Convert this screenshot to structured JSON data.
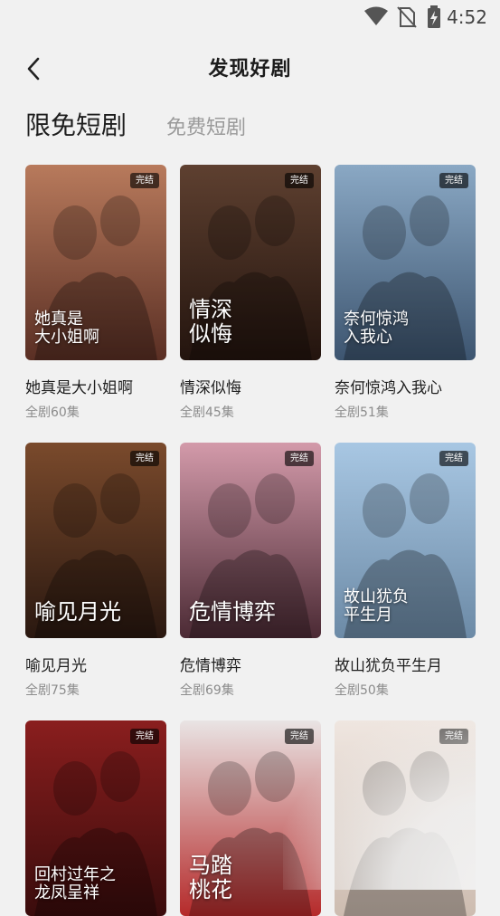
{
  "status_bar": {
    "time": "4:52",
    "icons": [
      "wifi-icon",
      "no-sim-icon",
      "battery-charging-icon"
    ]
  },
  "header": {
    "back_icon": "chevron-left-icon",
    "title": "发现好剧"
  },
  "tabs": [
    {
      "label": "限免短剧",
      "active": true
    },
    {
      "label": "免费短剧",
      "active": false
    }
  ],
  "dramas": [
    {
      "title": "她真是大小姐啊",
      "episodes": "全剧60集",
      "badge": "完结",
      "poster_text": "她真是\n大小姐啊",
      "colors": [
        "#b87a5c",
        "#5a2f24"
      ]
    },
    {
      "title": "情深似悔",
      "episodes": "全剧45集",
      "badge": "完结",
      "poster_text": "情深\n似悔",
      "colors": [
        "#5e4030",
        "#23140e"
      ]
    },
    {
      "title": "奈何惊鸿入我心",
      "episodes": "全剧51集",
      "badge": "完结",
      "poster_text": "奈何惊鸿\n入我心",
      "colors": [
        "#8aa8c4",
        "#3d5570"
      ]
    },
    {
      "title": "喻见月光",
      "episodes": "全剧75集",
      "badge": "完结",
      "poster_text": "喻见月光",
      "colors": [
        "#7a4a2c",
        "#2a1810"
      ]
    },
    {
      "title": "危情博弈",
      "episodes": "全剧69集",
      "badge": "完结",
      "poster_text": "危情博弈",
      "colors": [
        "#d39aaa",
        "#4b2a34"
      ]
    },
    {
      "title": "故山犹负平生月",
      "episodes": "全剧50集",
      "badge": "完结",
      "poster_text": "故山犹负\n平生月",
      "colors": [
        "#a8c7e3",
        "#6c8aa6"
      ]
    },
    {
      "title": "",
      "episodes": "",
      "badge": "完结",
      "poster_text": "回村过年之\n龙凤呈祥",
      "colors": [
        "#8a1e1e",
        "#3a0c0c"
      ]
    },
    {
      "title": "",
      "episodes": "",
      "badge": "完结",
      "poster_text": "马踏\n桃花",
      "colors": [
        "#e9e4e4",
        "#b52a2a"
      ]
    },
    {
      "title": "",
      "episodes": "",
      "badge": "完结",
      "poster_text": "",
      "colors": [
        "#efe6e0",
        "#cdbcb0"
      ]
    }
  ]
}
